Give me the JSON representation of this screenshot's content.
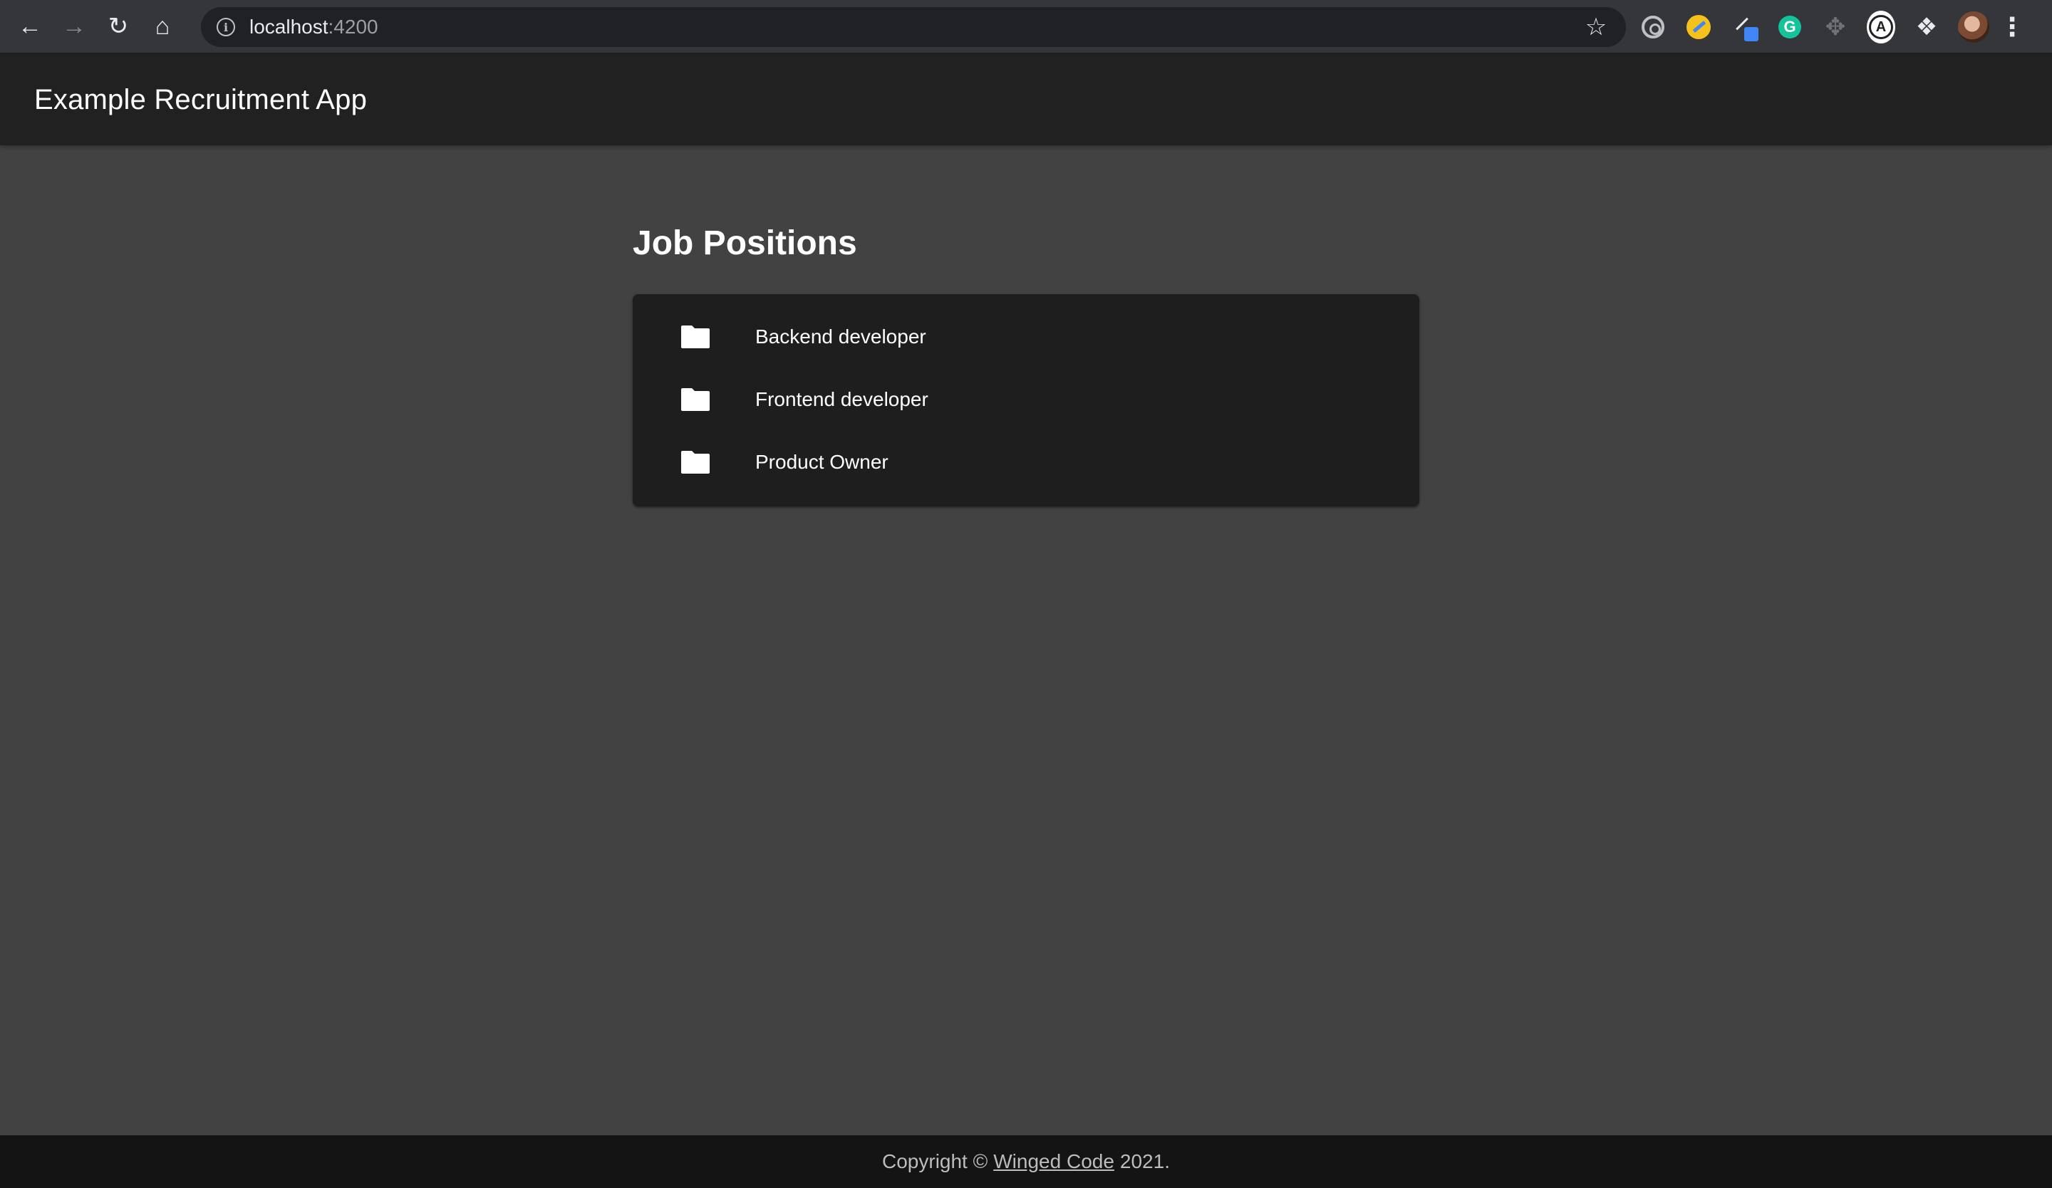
{
  "browser": {
    "url_host": "localhost",
    "url_port": ":4200",
    "icons": {
      "back": "back-arrow-icon",
      "forward": "forward-arrow-icon",
      "reload": "reload-icon",
      "home": "home-icon",
      "info": "info-icon",
      "bookmark": "star-icon",
      "extensions": [
        "target-extension-icon",
        "yellow-extension-icon",
        "pen-extension-icon",
        "grammarly-icon",
        "move-extension-icon",
        "a-extension-icon",
        "puzzle-icon"
      ],
      "menu": "menu-dots-icon"
    },
    "grammarly_letter": "G",
    "a_ext_letter": "A"
  },
  "app": {
    "title": "Example Recruitment App"
  },
  "main": {
    "title": "Job Positions",
    "positions": [
      {
        "label": "Backend developer",
        "icon": "folder-icon"
      },
      {
        "label": "Frontend developer",
        "icon": "folder-icon"
      },
      {
        "label": "Product Owner",
        "icon": "folder-icon"
      }
    ]
  },
  "footer": {
    "prefix": "Copyright ©",
    "link": "Winged Code",
    "suffix": "2021."
  },
  "colors": {
    "background": "#424242",
    "toolbar": "#212121",
    "card": "#1e1e1e",
    "footer": "#141414",
    "text": "#ffffff"
  }
}
